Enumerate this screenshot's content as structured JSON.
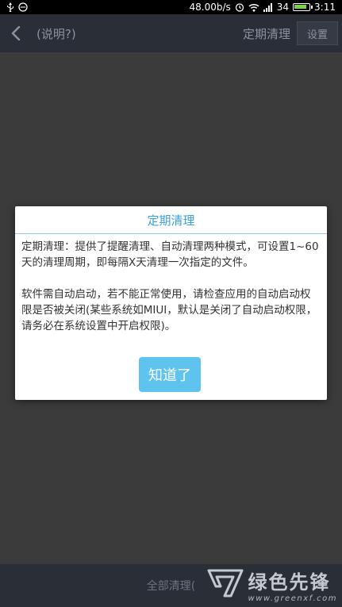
{
  "status_bar": {
    "net_speed": "48.00b/s",
    "signal_text": "34",
    "time": "3:11",
    "icons": [
      "usb-icon",
      "notification-icon",
      "alarm-icon",
      "wifi-icon",
      "signal-icon",
      "battery-icon"
    ],
    "battery_level": 0.9
  },
  "header": {
    "title": "(说明?)",
    "right_title": "定期清理",
    "settings_label": "设置"
  },
  "bottom": {
    "label": "全部清理("
  },
  "watermark": {
    "cn": "绿色先锋",
    "url": "www.greenxf.com"
  },
  "dialog": {
    "title": "定期清理",
    "paragraph1": "定期清理：提供了提醒清理、自动清理两种模式，可设置1~60天的清理周期，即每隔X天清理一次指定的文件。",
    "paragraph2": "软件需自动启动，若不能正常使用，请检查应用的自动启动权限是否被关闭(某些系统如MIUI，默认是关闭了自动启动权限，请务必在系统设置中开启权限)。",
    "ok_label": "知道了"
  },
  "colors": {
    "accent": "#3aa0d8",
    "button": "#5ec3ef",
    "header_bg": "#2a2e36",
    "overlay_bg": "#3b3b3b"
  }
}
